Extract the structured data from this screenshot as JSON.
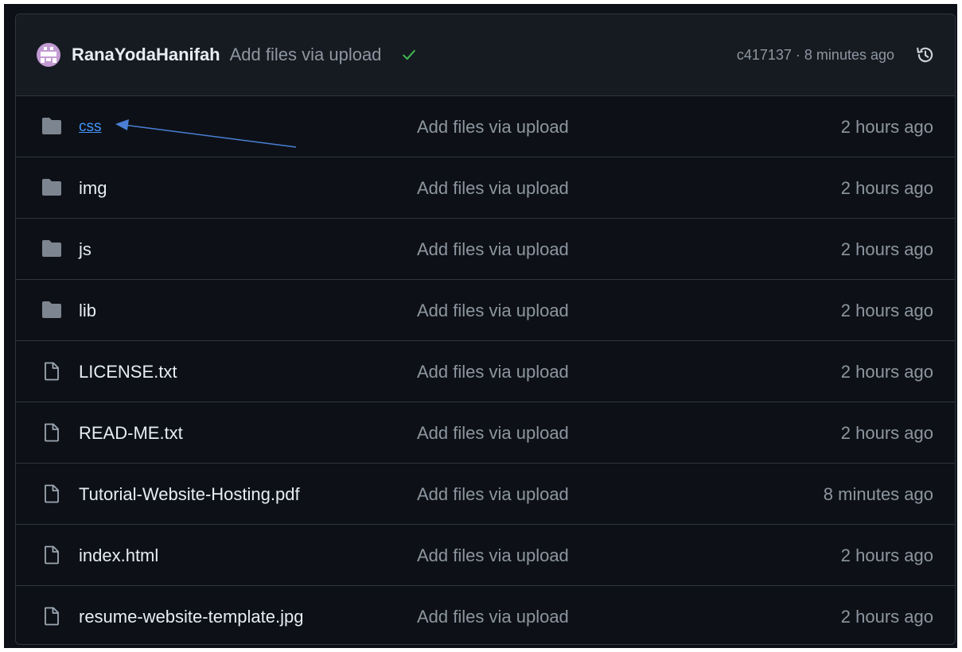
{
  "commit": {
    "author": "RanaYodaHanifah",
    "message": "Add files via upload",
    "status_icon": "check-icon",
    "status_color": "#3fb950",
    "hash": "c417137",
    "separator": "·",
    "time": "8 minutes ago",
    "history_icon": "history-icon"
  },
  "files": [
    {
      "name": "css",
      "type": "folder",
      "message": "Add files via upload",
      "age": "2 hours ago"
    },
    {
      "name": "img",
      "type": "folder",
      "message": "Add files via upload",
      "age": "2 hours ago"
    },
    {
      "name": "js",
      "type": "folder",
      "message": "Add files via upload",
      "age": "2 hours ago"
    },
    {
      "name": "lib",
      "type": "folder",
      "message": "Add files via upload",
      "age": "2 hours ago"
    },
    {
      "name": "LICENSE.txt",
      "type": "file",
      "message": "Add files via upload",
      "age": "2 hours ago"
    },
    {
      "name": "READ-ME.txt",
      "type": "file",
      "message": "Add files via upload",
      "age": "2 hours ago"
    },
    {
      "name": "Tutorial-Website-Hosting.pdf",
      "type": "file",
      "message": "Add files via upload",
      "age": "8 minutes ago"
    },
    {
      "name": "index.html",
      "type": "file",
      "message": "Add files via upload",
      "age": "2 hours ago"
    },
    {
      "name": "resume-website-template.jpg",
      "type": "file",
      "message": "Add files via upload",
      "age": "2 hours ago"
    }
  ],
  "colors": {
    "background": "#0d1117",
    "header_bg": "#161b22",
    "border": "#30363d",
    "link": "#4493f8",
    "annotation_arrow": "#4a7fd4"
  }
}
